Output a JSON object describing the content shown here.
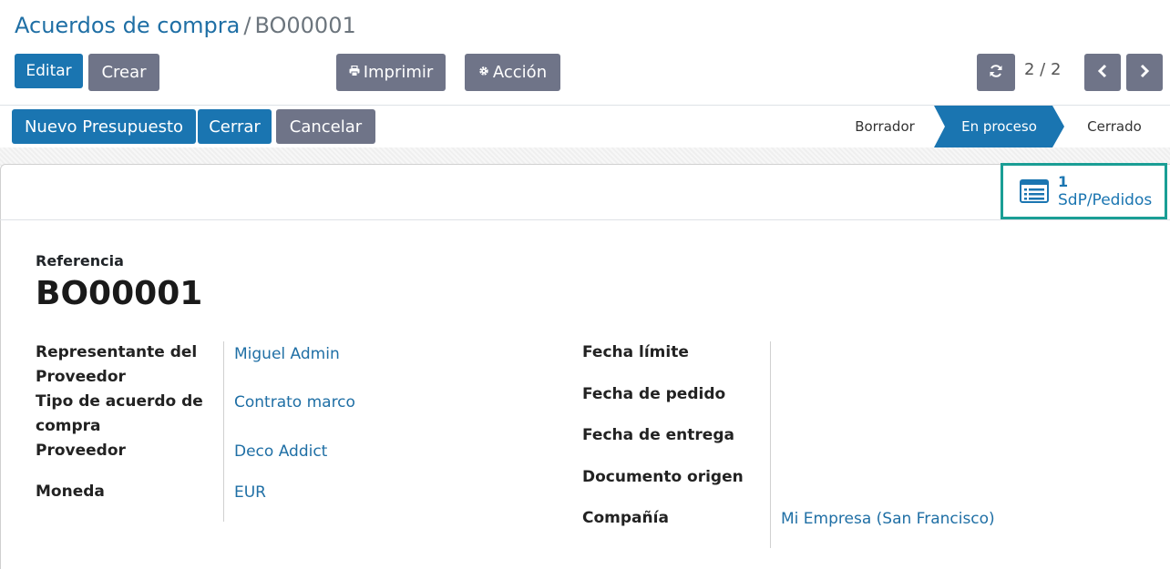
{
  "breadcrumb": {
    "parent": "Acuerdos de compra",
    "separator": "/",
    "current": "BO00001"
  },
  "toolbar": {
    "edit_label": "Editar",
    "create_label": "Crear",
    "print_label": "Imprimir",
    "action_label": "Acción",
    "pager": "2 / 2"
  },
  "statusbar": {
    "buttons": {
      "new_quote": "Nuevo Presupuesto",
      "close": "Cerrar",
      "cancel": "Cancelar"
    },
    "stages": {
      "draft": "Borrador",
      "in_progress": "En proceso",
      "closed": "Cerrado"
    },
    "active_stage": "En proceso"
  },
  "smart_button": {
    "count": "1",
    "label": "SdP/Pedidos"
  },
  "form": {
    "reference_label": "Referencia",
    "reference_value": "BO00001",
    "left_fields": {
      "vendor_rep": {
        "label": "Representante del Proveedor",
        "value": "Miguel Admin"
      },
      "agreement_type": {
        "label": "Tipo de acuerdo de compra",
        "value": "Contrato marco"
      },
      "vendor": {
        "label": "Proveedor",
        "value": "Deco Addict"
      },
      "currency": {
        "label": "Moneda",
        "value": "EUR"
      }
    },
    "right_fields": {
      "deadline": {
        "label": "Fecha límite",
        "value": ""
      },
      "order_date": {
        "label": "Fecha de pedido",
        "value": ""
      },
      "delivery_date": {
        "label": "Fecha de entrega",
        "value": ""
      },
      "source_doc": {
        "label": "Documento origen",
        "value": ""
      },
      "company": {
        "label": "Compañía",
        "value": "Mi Empresa (San Francisco)"
      }
    }
  },
  "colors": {
    "primary": "#1a75b1",
    "secondary": "#6f7488",
    "link": "#1f6fa5",
    "highlight_border": "#1a9e95"
  }
}
